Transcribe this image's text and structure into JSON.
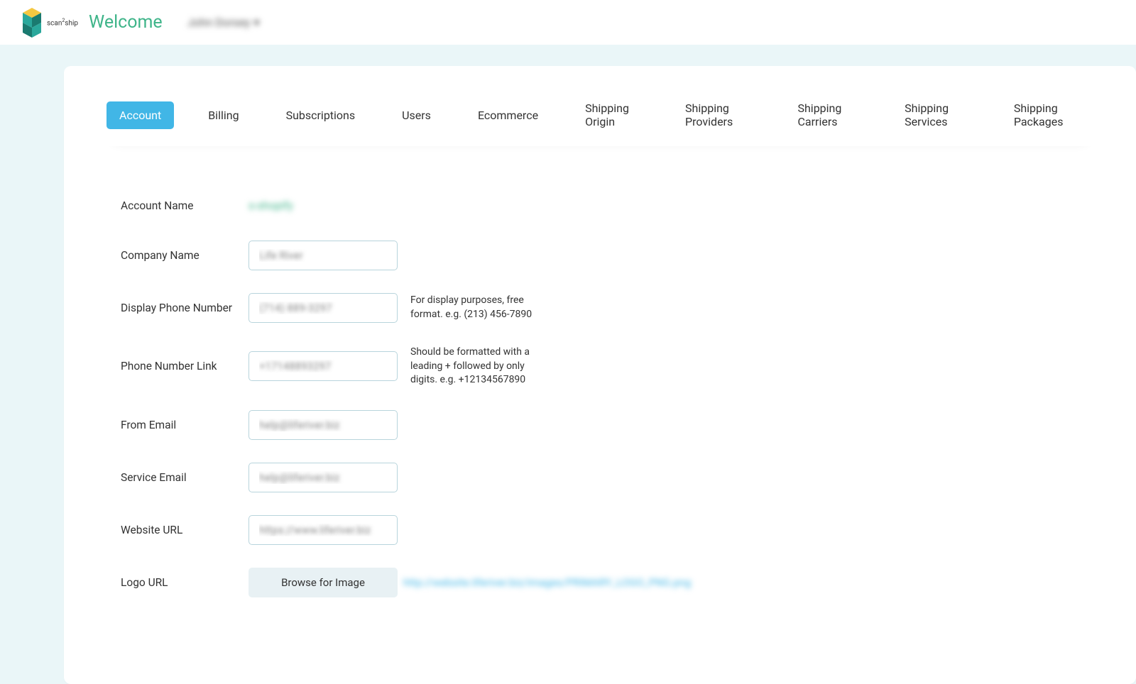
{
  "header": {
    "brand_main": "scan",
    "brand_sup": "2",
    "brand_end": "ship",
    "welcome": "Welcome",
    "username": "John Dorsey"
  },
  "tabs": [
    {
      "label": "Account",
      "active": true
    },
    {
      "label": "Billing",
      "active": false
    },
    {
      "label": "Subscriptions",
      "active": false
    },
    {
      "label": "Users",
      "active": false
    },
    {
      "label": "Ecommerce",
      "active": false
    },
    {
      "label": "Shipping Origin",
      "active": false
    },
    {
      "label": "Shipping Providers",
      "active": false
    },
    {
      "label": "Shipping Carriers",
      "active": false
    },
    {
      "label": "Shipping Services",
      "active": false
    },
    {
      "label": "Shipping Packages",
      "active": false
    }
  ],
  "form": {
    "account_name": {
      "label": "Account Name",
      "value": "s-shopify"
    },
    "company_name": {
      "label": "Company Name",
      "value": "Life River"
    },
    "display_phone": {
      "label": "Display Phone Number",
      "value": "(714) 889-3297",
      "help": "For display purposes, free format. e.g. (213) 456-7890"
    },
    "phone_link": {
      "label": "Phone Number Link",
      "value": "+17148893297",
      "help": "Should be formatted with a leading + followed by only digits. e.g. +12134567890"
    },
    "from_email": {
      "label": "From Email",
      "value": "help@liferiver.biz"
    },
    "service_email": {
      "label": "Service Email",
      "value": "help@liferiver.biz"
    },
    "website_url": {
      "label": "Website URL",
      "value": "https://www.liferiver.biz"
    },
    "logo_url": {
      "label": "Logo URL",
      "button": "Browse for Image",
      "value": "http://website.liferiver.biz/images/PRIMARY_LOGO_PNG.png"
    }
  }
}
